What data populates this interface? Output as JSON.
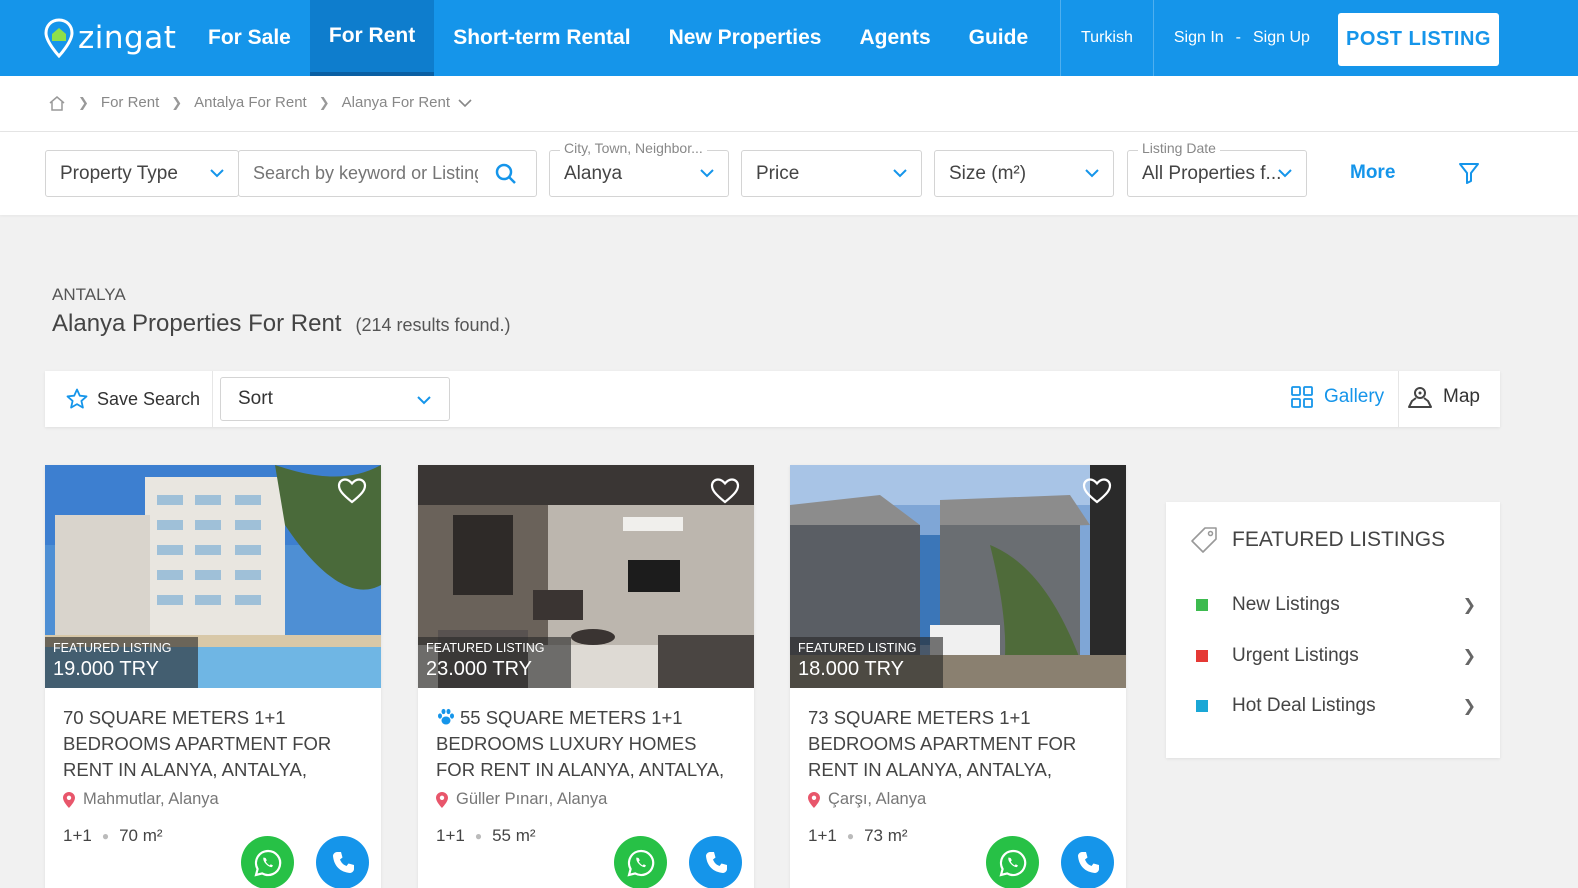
{
  "brand": {
    "name": "zingat",
    "accent": "#1595ea"
  },
  "nav": {
    "items": [
      {
        "label": "For Sale"
      },
      {
        "label": "For Rent",
        "active": true
      },
      {
        "label": "Short-term Rental"
      },
      {
        "label": "New Properties"
      },
      {
        "label": "Agents"
      },
      {
        "label": "Guide"
      }
    ],
    "language": "Turkish",
    "sign_in": "Sign In",
    "dash": "-",
    "sign_up": "Sign Up",
    "post_listing": "POST LISTING"
  },
  "breadcrumb": [
    "For Rent",
    "Antalya For Rent",
    "Alanya For Rent"
  ],
  "filters": {
    "property_type": "Property Type",
    "search_placeholder": "Search by keyword or Listing ID",
    "location_label": "City, Town, Neighbor...",
    "location_value": "Alanya",
    "price": "Price",
    "size": "Size (m²)",
    "listing_date_label": "Listing Date",
    "listing_date_value": "All Properties f...",
    "more": "More"
  },
  "heading": {
    "region": "ANTALYA",
    "title": "Alanya Properties For Rent",
    "results": "(214 results found.)"
  },
  "toolbar": {
    "save_search": "Save Search",
    "sort": "Sort",
    "gallery": "Gallery",
    "map": "Map"
  },
  "listings": [
    {
      "badge": "FEATURED LISTING",
      "price": "19.000 TRY",
      "title": "70 SQUARE METERS 1+1 BEDROOMS APARTMENT FOR RENT IN ALANYA, ANTALYA,",
      "location": "Mahmutlar, Alanya",
      "rooms": "1+1",
      "size": "70 m²"
    },
    {
      "badge": "FEATURED LISTING",
      "price": "23.000 TRY",
      "title": "55 SQUARE METERS 1+1 BEDROOMS LUXURY HOMES FOR RENT IN ALANYA, ANTALYA,",
      "location": "Güller Pınarı, Alanya",
      "rooms": "1+1",
      "size": "55 m²",
      "pet_friendly": true
    },
    {
      "badge": "FEATURED LISTING",
      "price": "18.000 TRY",
      "title": "73 SQUARE METERS 1+1 BEDROOMS APARTMENT FOR RENT IN ALANYA, ANTALYA,",
      "location": "Çarşı, Alanya",
      "rooms": "1+1",
      "size": "73 m²"
    }
  ],
  "featured": {
    "title": "FEATURED LISTINGS",
    "items": [
      {
        "label": "New Listings",
        "color": "#3dbb4f"
      },
      {
        "label": "Urgent Listings",
        "color": "#e53935"
      },
      {
        "label": "Hot Deal Listings",
        "color": "#1aa7d6"
      }
    ]
  }
}
